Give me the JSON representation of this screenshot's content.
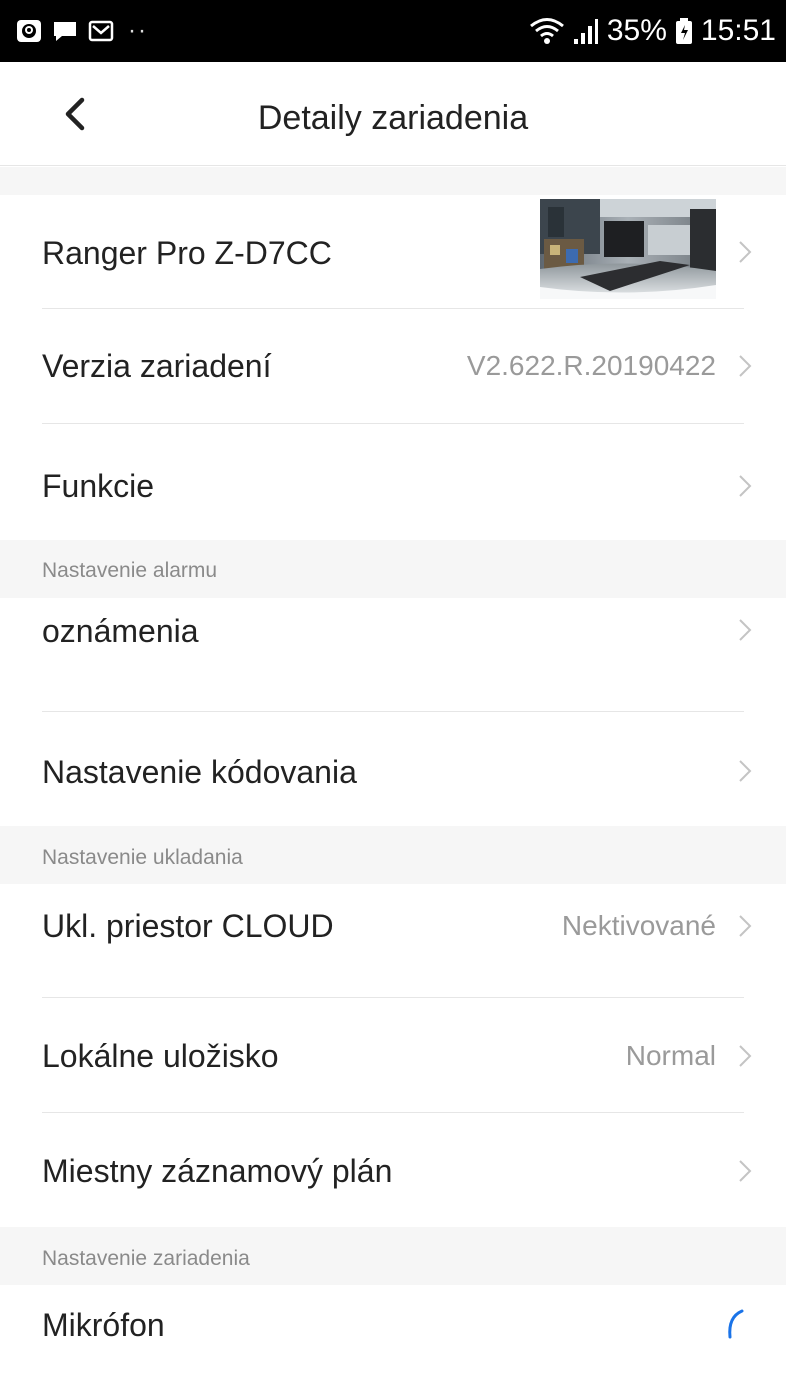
{
  "status_bar": {
    "battery": "35%",
    "time": "15:51"
  },
  "header": {
    "title": "Detaily zariadenia"
  },
  "rows": {
    "device_name": {
      "label": "Ranger Pro Z-D7CC"
    },
    "firmware": {
      "label": "Verzia zariadení",
      "value": "V2.622.R.20190422"
    },
    "features": {
      "label": "Funkcie"
    },
    "notifications": {
      "label": "oznámenia"
    },
    "encoding": {
      "label": "Nastavenie kódovania"
    },
    "cloud_storage": {
      "label": "Ukl. priestor CLOUD",
      "value": "Nektivované"
    },
    "local_storage": {
      "label": "Lokálne uložisko",
      "value": "Normal"
    },
    "recording_plan": {
      "label": "Miestny záznamový plán"
    },
    "microphone": {
      "label": "Mikrófon"
    }
  },
  "sections": {
    "alarm": "Nastavenie alarmu",
    "storage": "Nastavenie ukladania",
    "device": "Nastavenie zariadenia"
  },
  "icons": {
    "back": "chevron-left-icon",
    "row_arrow": "chevron-right-icon",
    "loading": "spinner-icon"
  },
  "colors": {
    "status_bar": "#000000",
    "section_bg": "#f6f6f6",
    "divider": "#e6e6e6",
    "secondary_text": "#9a9a9a",
    "accent": "#1a73e8"
  }
}
